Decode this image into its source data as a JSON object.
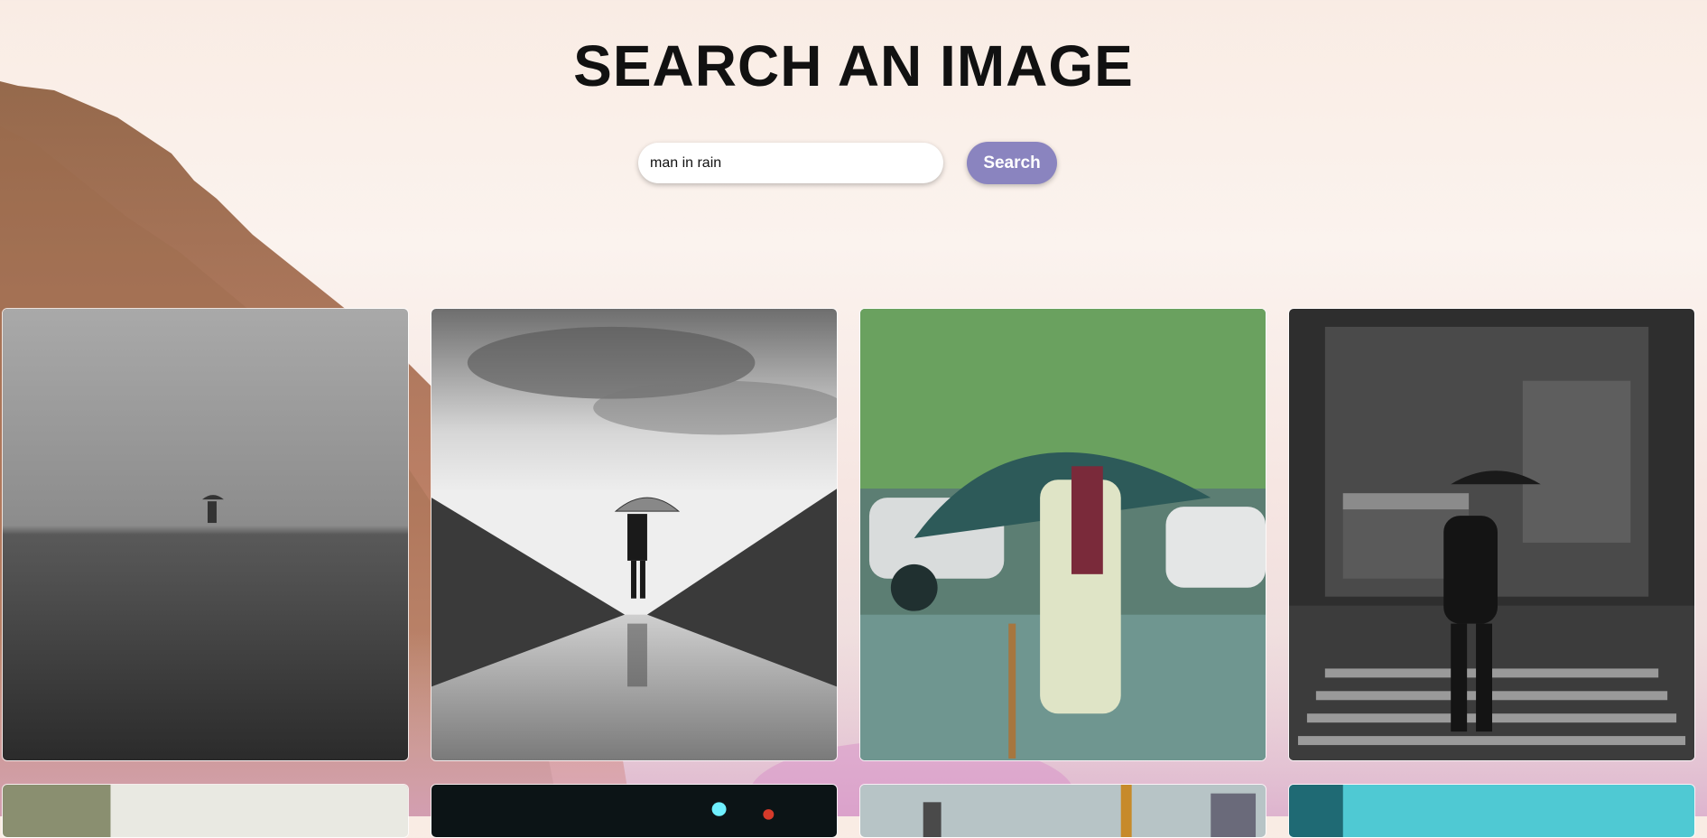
{
  "header": {
    "title": "SEARCH AN IMAGE"
  },
  "search": {
    "value": "man in rain",
    "button_label": "Search"
  },
  "results": [
    {
      "scene": "foggy-field-umbrella-photo"
    },
    {
      "scene": "bridge-reflection-umbrella-photo"
    },
    {
      "scene": "old-man-green-umbrella-photo"
    },
    {
      "scene": "crosswalk-night-umbrella-photo"
    },
    {
      "scene": "partial-photo-5"
    },
    {
      "scene": "partial-photo-6"
    },
    {
      "scene": "partial-photo-7"
    },
    {
      "scene": "partial-photo-8"
    }
  ],
  "colors": {
    "button": "#8a84bf",
    "heading": "#111111",
    "input_bg": "#ffffff"
  }
}
